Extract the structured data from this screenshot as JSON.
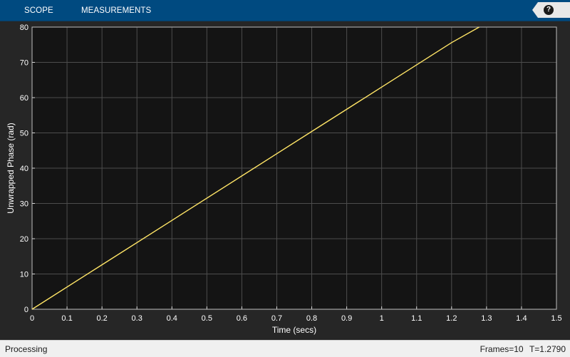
{
  "toolstrip": {
    "tabs": [
      "SCOPE",
      "MEASUREMENTS"
    ],
    "help_label": "?"
  },
  "colors": {
    "toolstrip": "#004a80",
    "figure": "#262626",
    "axes": "#141414",
    "grid": "#4d4d4d",
    "text": "#ffffff",
    "line": "#ffe566"
  },
  "chart_data": {
    "type": "line",
    "title": "",
    "xlabel": "Time (secs)",
    "ylabel": "Unwrapped Phase (rad)",
    "xlim": [
      0,
      1.5
    ],
    "ylim": [
      0,
      80
    ],
    "xticks": [
      "0",
      "0.1",
      "0.2",
      "0.3",
      "0.4",
      "0.5",
      "0.6",
      "0.7",
      "0.8",
      "0.9",
      "1",
      "1.1",
      "1.2",
      "1.3",
      "1.4",
      "1.5"
    ],
    "yticks": [
      "0",
      "10",
      "20",
      "30",
      "40",
      "50",
      "60",
      "70",
      "80"
    ],
    "grid": true,
    "series": [
      {
        "x": [
          0,
          0.2,
          0.4,
          0.6,
          0.8,
          1.0,
          1.2,
          1.279
        ],
        "y": [
          0,
          12.6,
          25.2,
          37.8,
          50.4,
          63.0,
          75.6,
          80.0
        ]
      }
    ]
  },
  "status": {
    "left": "Processing",
    "frames": "Frames=10",
    "time": "T=1.2790"
  }
}
